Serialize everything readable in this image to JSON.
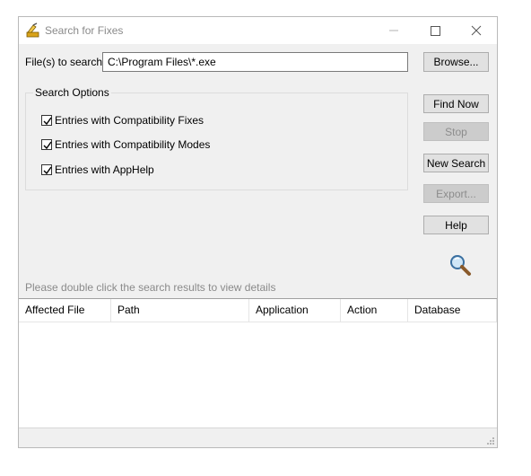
{
  "window": {
    "title": "Search for Fixes"
  },
  "search": {
    "label": "File(s) to search:",
    "value": "C:\\Program Files\\*.exe",
    "browse_label": "Browse..."
  },
  "options": {
    "title": "Search Options",
    "items": [
      {
        "label": "Entries with Compatibility Fixes",
        "checked": true
      },
      {
        "label": "Entries with Compatibility Modes",
        "checked": true
      },
      {
        "label": "Entries with AppHelp",
        "checked": true
      }
    ]
  },
  "buttons": {
    "find_now": "Find Now",
    "stop": "Stop",
    "new_search": "New Search",
    "export": "Export...",
    "help": "Help"
  },
  "hint": "Please double click the search results to view details",
  "results": {
    "columns": [
      "Affected File",
      "Path",
      "Application",
      "Action",
      "Database"
    ],
    "rows": []
  },
  "icons": {
    "app": "fix-app-icon",
    "search": "magnifier-icon"
  }
}
